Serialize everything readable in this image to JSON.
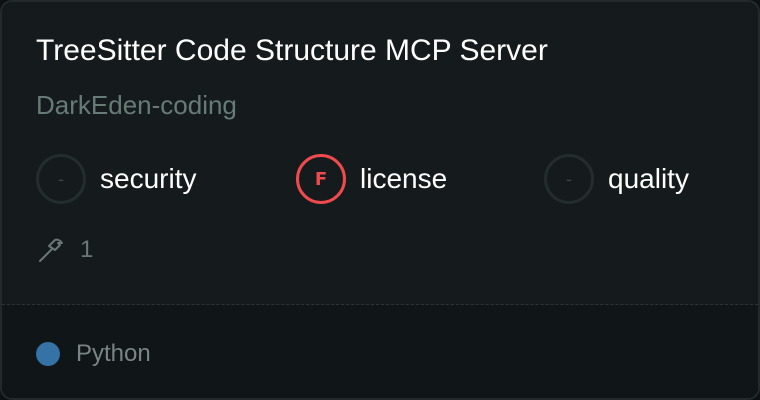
{
  "card": {
    "title": "TreeSitter Code Structure MCP Server",
    "author": "DarkEden-coding",
    "badges": [
      {
        "grade": "-",
        "label": "security"
      },
      {
        "grade": "F",
        "label": "license",
        "color": "#f14a4e"
      },
      {
        "grade": "-",
        "label": "quality"
      }
    ],
    "tools": {
      "icon": "hammer-icon",
      "count": "1"
    },
    "language": {
      "name": "Python",
      "color": "#3572a5"
    }
  }
}
